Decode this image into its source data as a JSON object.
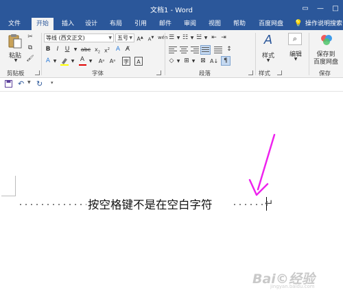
{
  "window": {
    "title": "文档1 - Word"
  },
  "tabs": [
    {
      "label": "文件"
    },
    {
      "label": "开始"
    },
    {
      "label": "插入"
    },
    {
      "label": "设计"
    },
    {
      "label": "布局"
    },
    {
      "label": "引用"
    },
    {
      "label": "邮件"
    },
    {
      "label": "审阅"
    },
    {
      "label": "视图"
    },
    {
      "label": "帮助"
    },
    {
      "label": "百度网盘"
    },
    {
      "label": "操作说明搜索"
    }
  ],
  "ribbon": {
    "clipboard": {
      "paste_label": "粘贴",
      "group_label": "剪贴板"
    },
    "font": {
      "font_name": "等线 (西文正文)",
      "font_size": "五号",
      "group_label": "字体",
      "wen_glyph": "wén",
      "a_glyph": "A"
    },
    "paragraph": {
      "group_label": "段落"
    },
    "styles": {
      "button_label": "样式",
      "group_label": "样式"
    },
    "editing": {
      "button_label": "编辑"
    },
    "save": {
      "button_label_1": "保存到",
      "button_label_2": "百度网盘",
      "group_label": "保存"
    }
  },
  "document": {
    "line_text": "按空格键不是在空白字符",
    "pilcrow": "↵"
  },
  "watermark": {
    "main": "Bai©经验",
    "sub": "jingyan.baidu.com"
  },
  "colors": {
    "accent": "#2b579a",
    "arrow": "#ee22ee"
  }
}
